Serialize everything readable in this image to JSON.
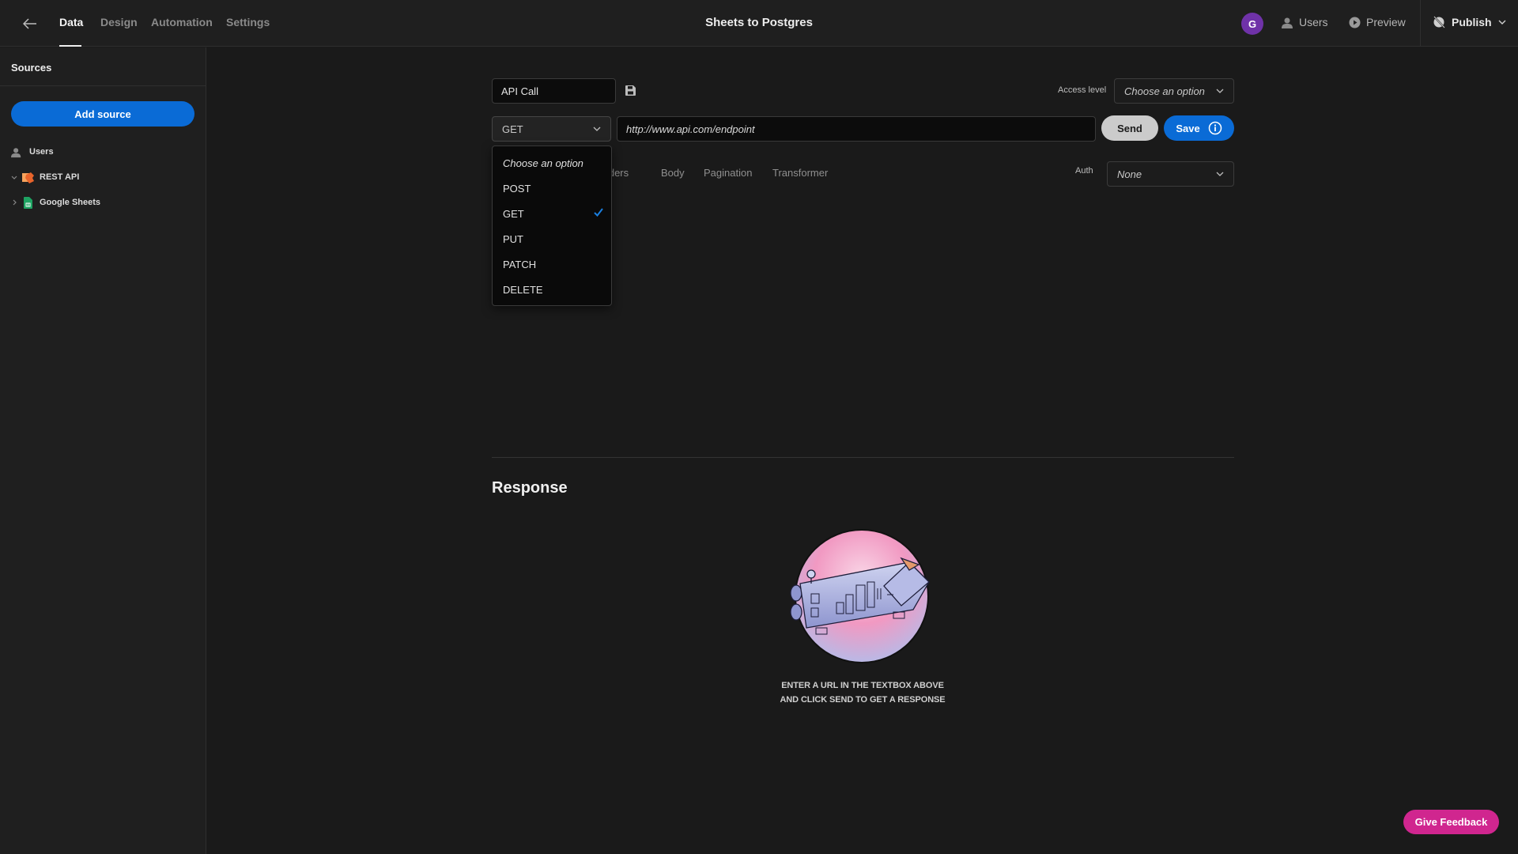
{
  "topbar": {
    "back_icon": "arrow-left-icon",
    "tabs": [
      {
        "label": "Data",
        "active": true
      },
      {
        "label": "Design",
        "active": false
      },
      {
        "label": "Automation",
        "active": false
      },
      {
        "label": "Settings",
        "active": false
      }
    ],
    "title": "Sheets to Postgres",
    "avatar_initial": "G",
    "avatar_color": "#6f32a8",
    "users_label": "Users",
    "preview_label": "Preview",
    "publish_label": "Publish"
  },
  "sidebar": {
    "title": "Sources",
    "add_source_label": "Add source",
    "items": [
      {
        "label": "Users",
        "icon": "users-icon",
        "expandable": false
      },
      {
        "label": "REST API",
        "icon": "rest-api-icon",
        "expandable": true,
        "expanded": true
      },
      {
        "label": "Google Sheets",
        "icon": "google-sheets-icon",
        "expandable": true,
        "expanded": false
      }
    ]
  },
  "query": {
    "name_value": "API Call",
    "access_level_label": "Access level",
    "access_level_value": "Choose an option",
    "method_value": "GET",
    "url_value": "http://www.api.com/endpoint",
    "send_label": "Send",
    "save_label": "Save",
    "tabs": [
      "Headers",
      "Body",
      "Pagination",
      "Transformer"
    ],
    "auth_label": "Auth",
    "auth_value": "None"
  },
  "method_dropdown": {
    "placeholder": "Choose an option",
    "options": [
      {
        "label": "POST",
        "selected": false
      },
      {
        "label": "GET",
        "selected": true
      },
      {
        "label": "PUT",
        "selected": false
      },
      {
        "label": "PATCH",
        "selected": false
      },
      {
        "label": "DELETE",
        "selected": false
      }
    ]
  },
  "response": {
    "title": "Response",
    "hint_line1": "ENTER A URL IN THE TEXTBOX ABOVE",
    "hint_line2": "AND CLICK SEND TO GET A RESPONSE"
  },
  "feedback_label": "Give Feedback",
  "colors": {
    "accent": "#0a6bd6",
    "feedback": "#d0268f",
    "background": "#1a1a1a"
  }
}
